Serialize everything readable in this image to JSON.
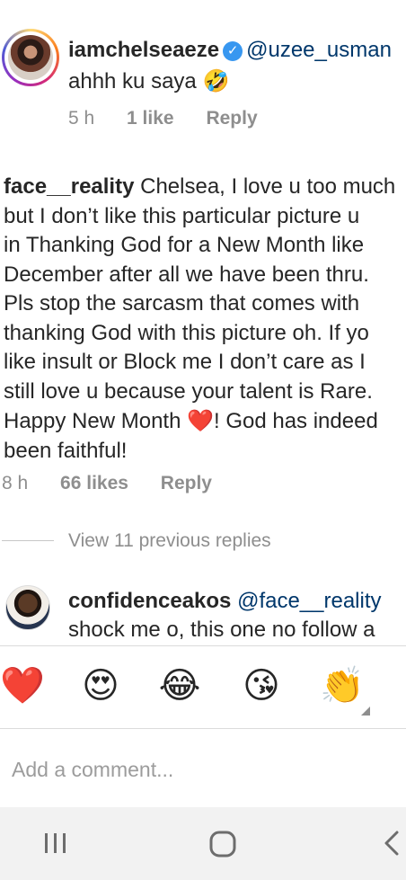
{
  "comment1": {
    "username": "iamchelseaeze",
    "verified_icon": "verified-check-icon",
    "mention": "@uzee_usman",
    "text": "ahhh ku saya",
    "emoji": "🤣",
    "time": "5 h",
    "likes": "1 like",
    "reply": "Reply"
  },
  "comment2": {
    "username": "face__reality",
    "lines": [
      " Chelsea, I love u too much",
      "but I don’t like this particular picture u",
      "in Thanking God for a New Month like",
      "December after all we have been thru.",
      "Pls stop the sarcasm that comes with",
      "thanking God with this picture oh. If yo",
      "like insult or Block me I don’t care as I",
      "still love u because your talent is Rare.",
      "Happy New Month "
    ],
    "heart_emoji": "❤️",
    "line9_tail": "! God has indeed",
    "line10": "been faithful!",
    "time": "8 h",
    "likes": "66 likes",
    "reply": "Reply"
  },
  "view_replies": "View 11 previous replies",
  "reply1": {
    "username": "confidenceakos",
    "mention": " @face__reality",
    "text": "shock me o, this one no follow a"
  },
  "reactions": [
    "❤️",
    "😍",
    "😂",
    "😘",
    "👏"
  ],
  "add_comment_placeholder": "Add a comment...",
  "navbar": {
    "recent_icon": "recent-apps-icon",
    "home_icon": "home-icon",
    "back_icon": "back-icon"
  }
}
